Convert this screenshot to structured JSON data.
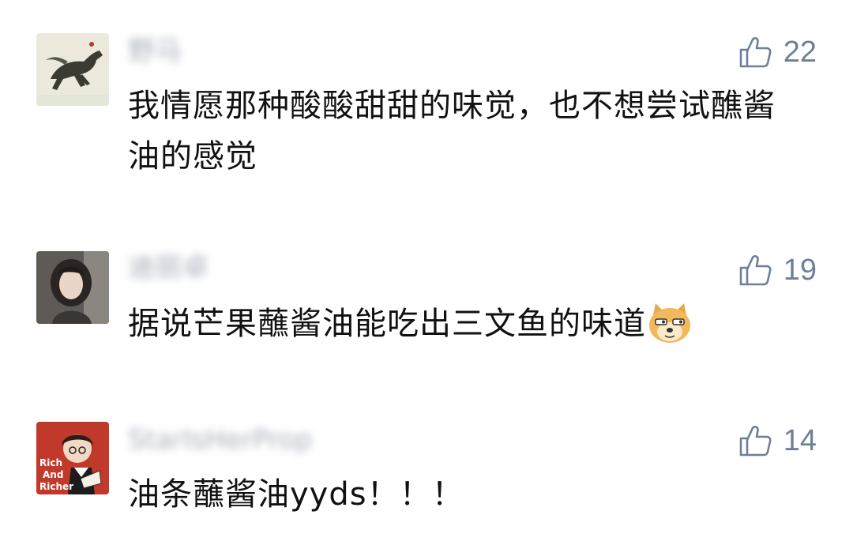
{
  "comments": [
    {
      "username": "野马",
      "likes": "22",
      "text": "我情愿那种酸酸甜甜的味觉，也不想尝试醮酱油的感觉",
      "avatar_icon": "horse-painting-avatar"
    },
    {
      "username": "迪丽卓",
      "likes": "19",
      "text": "据说芒果蘸酱油能吃出三文鱼的味道",
      "emoji": "doge-emoji",
      "avatar_icon": "girl-photo-avatar"
    },
    {
      "username": "StarIsHerProp",
      "likes": "14",
      "text": "油条蘸酱油yyds！！！",
      "avatar_icon": "rich-and-richer-avatar",
      "avatar_text": [
        "Rich",
        "And",
        "Richer"
      ]
    }
  ],
  "colors": {
    "like_icon": "#6f7f99",
    "like_count": "#6f7f99",
    "username_blurred": "#aab0bd",
    "comment_text": "#111111",
    "background": "#ffffff"
  }
}
